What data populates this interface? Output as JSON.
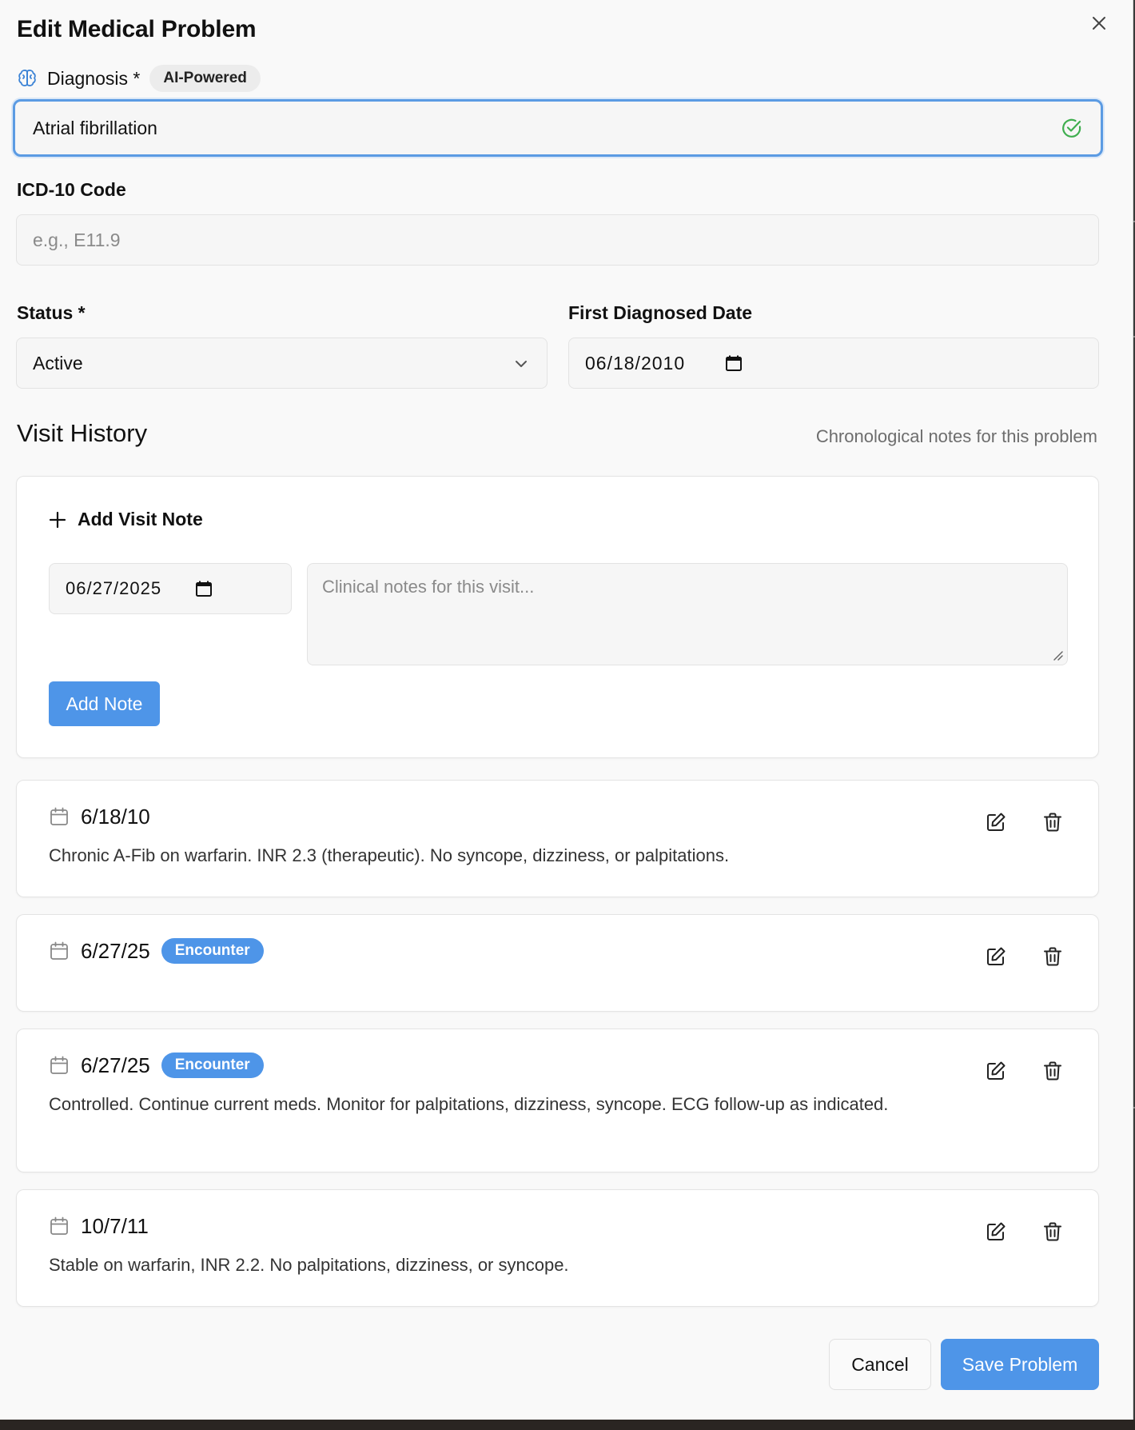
{
  "dialog": {
    "title": "Edit Medical Problem",
    "close_icon": "close-icon"
  },
  "diagnosis": {
    "label": "Diagnosis *",
    "badge": "AI-Powered",
    "value": "Atrial fibrillation",
    "icon": "brain-icon",
    "valid_icon": "check-circle-icon"
  },
  "icd": {
    "label": "ICD-10 Code",
    "placeholder": "e.g., E11.9",
    "value": ""
  },
  "status": {
    "label": "Status *",
    "value": "Active"
  },
  "first_diagnosed": {
    "label": "First Diagnosed Date",
    "value": "06/18/2010"
  },
  "visit_history": {
    "title": "Visit History",
    "subtitle": "Chronological notes for this problem",
    "add_note": {
      "heading": "Add Visit Note",
      "date_value": "06/27/2025",
      "notes_placeholder": "Clinical notes for this visit...",
      "button_label": "Add Note"
    },
    "entries": [
      {
        "date": "6/18/10",
        "badge": "",
        "note": "Chronic A-Fib on warfarin. INR 2.3 (therapeutic). No syncope, dizziness, or palpitations."
      },
      {
        "date": "6/27/25",
        "badge": "Encounter",
        "note": ""
      },
      {
        "date": "6/27/25",
        "badge": "Encounter",
        "note": "Controlled. Continue current meds. Monitor for palpitations, dizziness, syncope. ECG follow-up as indicated."
      },
      {
        "date": "10/7/11",
        "badge": "",
        "note": "Stable on warfarin, INR 2.2. No palpitations, dizziness, or syncope."
      }
    ]
  },
  "footer": {
    "cancel_label": "Cancel",
    "save_label": "Save Problem"
  },
  "colors": {
    "accent": "#4e95e8",
    "focus_border": "#5b9be3",
    "valid_green": "#3fae4f"
  }
}
